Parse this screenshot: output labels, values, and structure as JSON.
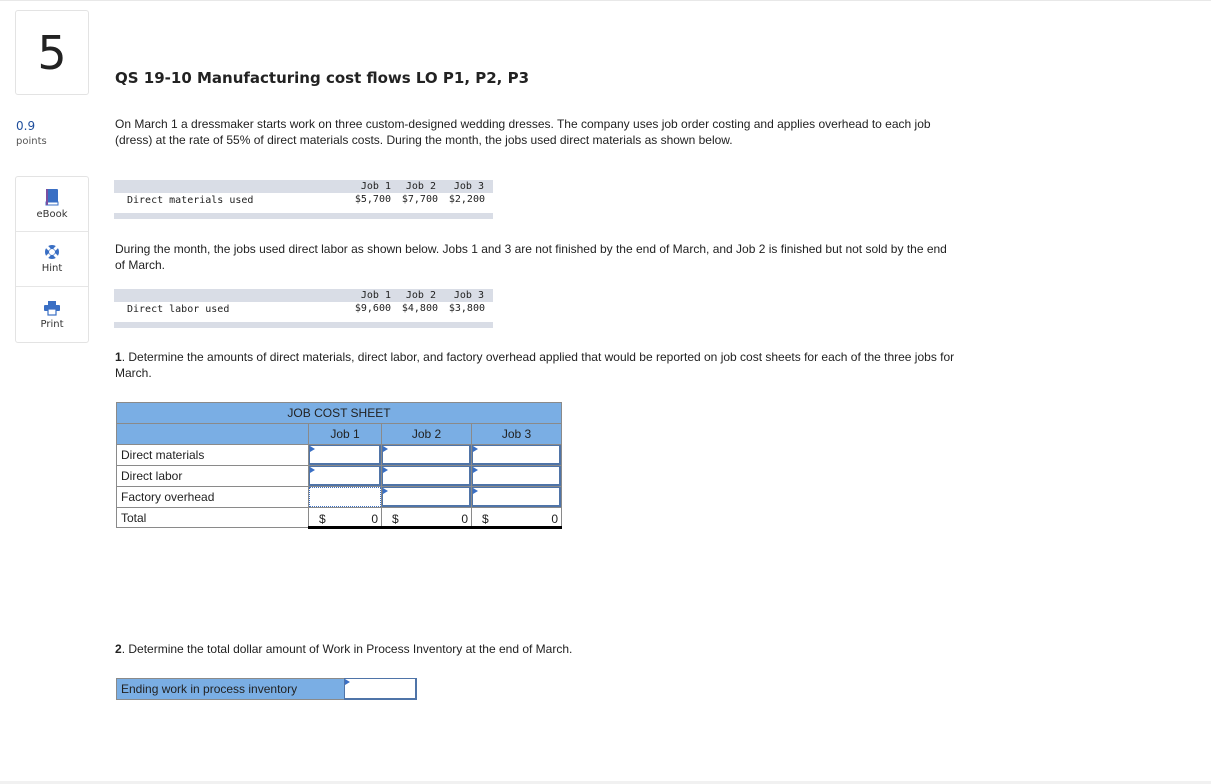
{
  "question": {
    "number": "5",
    "points_value": "0.9",
    "points_label": "points",
    "title": "QS 19-10 Manufacturing cost flows LO P1, P2, P3"
  },
  "tools": [
    {
      "label": "eBook",
      "icon": "book-icon"
    },
    {
      "label": "Hint",
      "icon": "lifebuoy-icon"
    },
    {
      "label": "Print",
      "icon": "printer-icon"
    }
  ],
  "colors": {
    "accent_blue": "#7aaee4",
    "input_border": "#4f74a8",
    "icon_blue": "#3a6fc4",
    "given_band": "#d9dde6"
  },
  "paragraphs": {
    "intro": "On March 1 a dressmaker starts work on three custom-designed wedding dresses. The company uses job order costing and applies overhead to each job (dress) at the rate of 55% of direct materials costs. During the month, the jobs used direct materials as shown below.",
    "labor_intro": "During the month, the jobs used direct labor as shown below. Jobs 1 and 3 are not finished by the end of March, and Job 2 is finished but not sold by the end of March.",
    "part1_num": "1",
    "part1_text": ". Determine the amounts of direct materials, direct labor, and factory overhead applied that would be reported on job cost sheets for each of the three jobs for March.",
    "part2_num": "2",
    "part2_text": ". Determine the total dollar amount of Work in Process Inventory at the end of March."
  },
  "given_materials": {
    "headers": [
      "Job 1",
      "Job 2",
      "Job 3"
    ],
    "label": "Direct materials used",
    "values": [
      "$5,700",
      "$7,700",
      "$2,200"
    ]
  },
  "given_labor": {
    "headers": [
      "Job 1",
      "Job 2",
      "Job 3"
    ],
    "label": "Direct labor used",
    "values": [
      "$9,600",
      "$4,800",
      "$3,800"
    ]
  },
  "job_cost_sheet": {
    "title": "JOB COST SHEET",
    "columns": [
      "Job 1",
      "Job 2",
      "Job 3"
    ],
    "rows": [
      {
        "label": "Direct materials",
        "values": [
          "",
          "",
          ""
        ]
      },
      {
        "label": "Direct labor",
        "values": [
          "",
          "",
          ""
        ]
      },
      {
        "label": "Factory overhead",
        "values": [
          "",
          "",
          ""
        ]
      }
    ],
    "total": {
      "label": "Total",
      "currency": "$",
      "values": [
        "0",
        "0",
        "0"
      ]
    }
  },
  "wip": {
    "label": "Ending work in process inventory",
    "value": ""
  }
}
